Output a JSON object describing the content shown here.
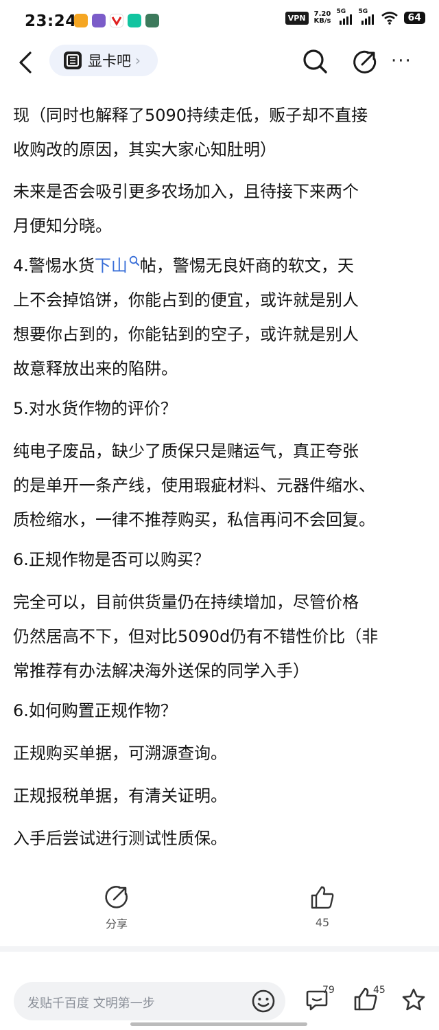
{
  "status_bar": {
    "time": "23:24",
    "vpn": "VPN",
    "speed_value": "7.20",
    "speed_unit": "KB/s",
    "net1": "5G",
    "net2": "5G",
    "battery": "64"
  },
  "nav": {
    "forum_name": "显卡吧",
    "chevron": "›",
    "more": "···"
  },
  "post": {
    "lines": [
      {
        "text": "现（同时也解释了5090持续走低，贩子却不直接"
      },
      {
        "text": "收购改的原因，其实大家心知肚明）"
      },
      {
        "text": "未来是否会吸引更多农场加入，且待接下来两个"
      },
      {
        "text": "月便知分晓。"
      },
      {
        "pre": "4.警惕水货",
        "link": "下山",
        "post": "帖，警惕无良奸商的软文，天"
      },
      {
        "text": "上不会掉馅饼，你能占到的便宜，或许就是别人"
      },
      {
        "text": "想要你占到的，你能钻到的空子，或许就是别人"
      },
      {
        "text": "故意释放出来的陷阱。"
      },
      {
        "text": "5.对水货作物的评价？"
      },
      {
        "text": "纯电子废品，缺少了质保只是赌运气，真正夸张"
      },
      {
        "text": "的是单开一条产线，使用瑕疵材料、元器件缩水、"
      },
      {
        "text": "质检缩水，一律不推荐购买，私信再问不会回复。"
      },
      {
        "text": "6.正规作物是否可以购买？"
      },
      {
        "text": "完全可以，目前供货量仍在持续增加，尽管价格"
      },
      {
        "text": "仍然居高不下，但对比5090d仍有不错性价比（非"
      },
      {
        "text": "常推荐有办法解决海外送保的同学入手）"
      },
      {
        "text": "6.如何购置正规作物？"
      },
      {
        "text": "正规购买单据，可溯源查询。"
      },
      {
        "text": "正规报税单据，有清关证明。"
      },
      {
        "text": "入手后尝试进行测试性质保。"
      }
    ]
  },
  "actions": {
    "share_label": "分享",
    "like_count": "45"
  },
  "bottom": {
    "comment_placeholder": "发贴千百度 文明第一步",
    "comment_count": "79",
    "like_count": "45"
  },
  "icons": {
    "back": "back-arrow-icon",
    "search": "search-icon",
    "share": "share-icon",
    "more": "more-icon",
    "emoji": "emoji-icon",
    "comment": "comment-icon",
    "like": "thumbs-up-icon",
    "star": "star-icon"
  },
  "colors": {
    "link": "#3a6fd8",
    "pill_bg": "#eef2fb",
    "input_bg": "#f1f2f4"
  }
}
